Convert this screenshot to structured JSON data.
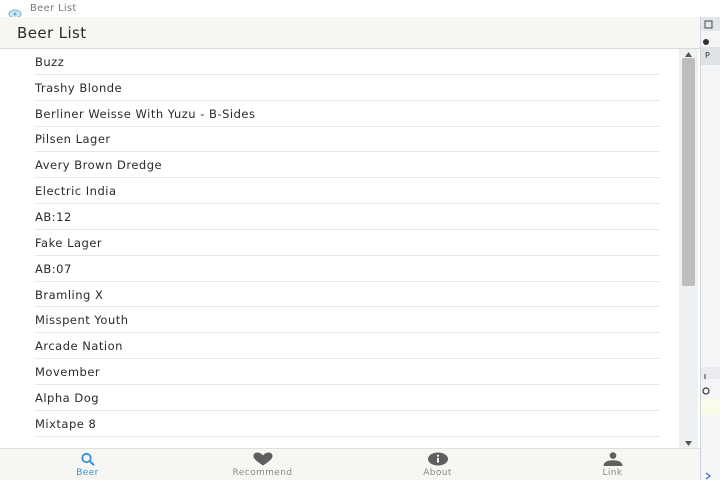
{
  "window": {
    "title": "Beer List"
  },
  "header": {
    "title": "Beer List"
  },
  "beers": [
    "Buzz",
    "Trashy Blonde",
    "Berliner Weisse With Yuzu - B-Sides",
    "Pilsen Lager",
    "Avery Brown Dredge",
    "Electric India",
    "AB:12",
    "Fake Lager",
    "AB:07",
    "Bramling X",
    "Misspent Youth",
    "Arcade Nation",
    "Movember",
    "Alpha Dog",
    "Mixtape 8"
  ],
  "nav": {
    "items": [
      {
        "label": "Beer",
        "icon": "search-icon",
        "active": true
      },
      {
        "label": "Recommend",
        "icon": "heart-icon",
        "active": false
      },
      {
        "label": "About",
        "icon": "info-icon",
        "active": false
      },
      {
        "label": "Link",
        "icon": "user-icon",
        "active": false
      }
    ]
  },
  "side_strip": {
    "label_p": "P",
    "label_s": "S"
  },
  "colors": {
    "accent": "#3b8fd6",
    "nav_inactive": "#8a8a8a",
    "header_bg": "#f6f6f3"
  }
}
